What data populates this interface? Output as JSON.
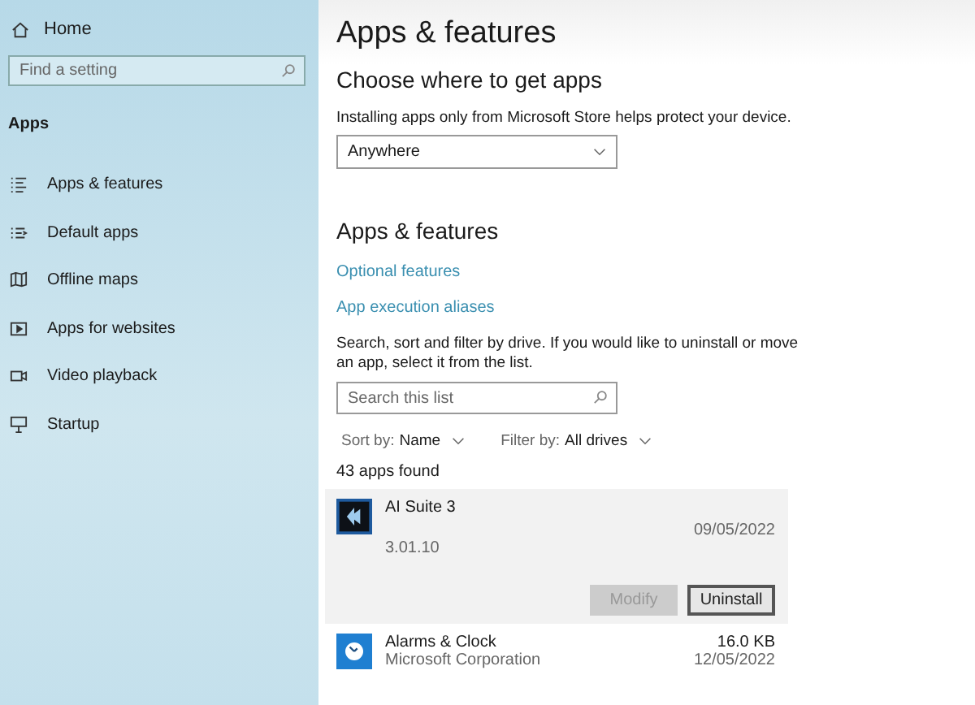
{
  "sidebar": {
    "home": "Home",
    "search": {
      "placeholder": "Find a setting"
    },
    "section": "Apps",
    "items": [
      {
        "label": "Apps & features"
      },
      {
        "label": "Default apps"
      },
      {
        "label": "Offline maps"
      },
      {
        "label": "Apps for websites"
      },
      {
        "label": "Video playback"
      },
      {
        "label": "Startup"
      }
    ]
  },
  "main": {
    "title": "Apps & features",
    "source_heading": "Choose where to get apps",
    "source_note": "Installing apps only from Microsoft Store helps protect your device.",
    "source_dropdown": "Anywhere",
    "apps_heading": "Apps & features",
    "links": [
      "Optional features",
      "App execution aliases"
    ],
    "list_note": "Search, sort and filter by drive. If you would like to uninstall or move an app, select it from the list.",
    "list_search": {
      "placeholder": "Search this list"
    },
    "sort": {
      "label": "Sort by:",
      "value": "Name"
    },
    "filter": {
      "label": "Filter by:",
      "value": "All drives"
    },
    "count": "43 apps found",
    "apps": [
      {
        "name": "AI Suite 3",
        "version": "3.01.10",
        "date": "09/05/2022",
        "selected": true,
        "buttons": [
          {
            "label": "Modify",
            "disabled": true
          },
          {
            "label": "Uninstall",
            "disabled": false
          }
        ]
      },
      {
        "name": "Alarms & Clock",
        "publisher": "Microsoft Corporation",
        "size": "16.0 KB",
        "date": "12/05/2022",
        "selected": false
      }
    ]
  }
}
